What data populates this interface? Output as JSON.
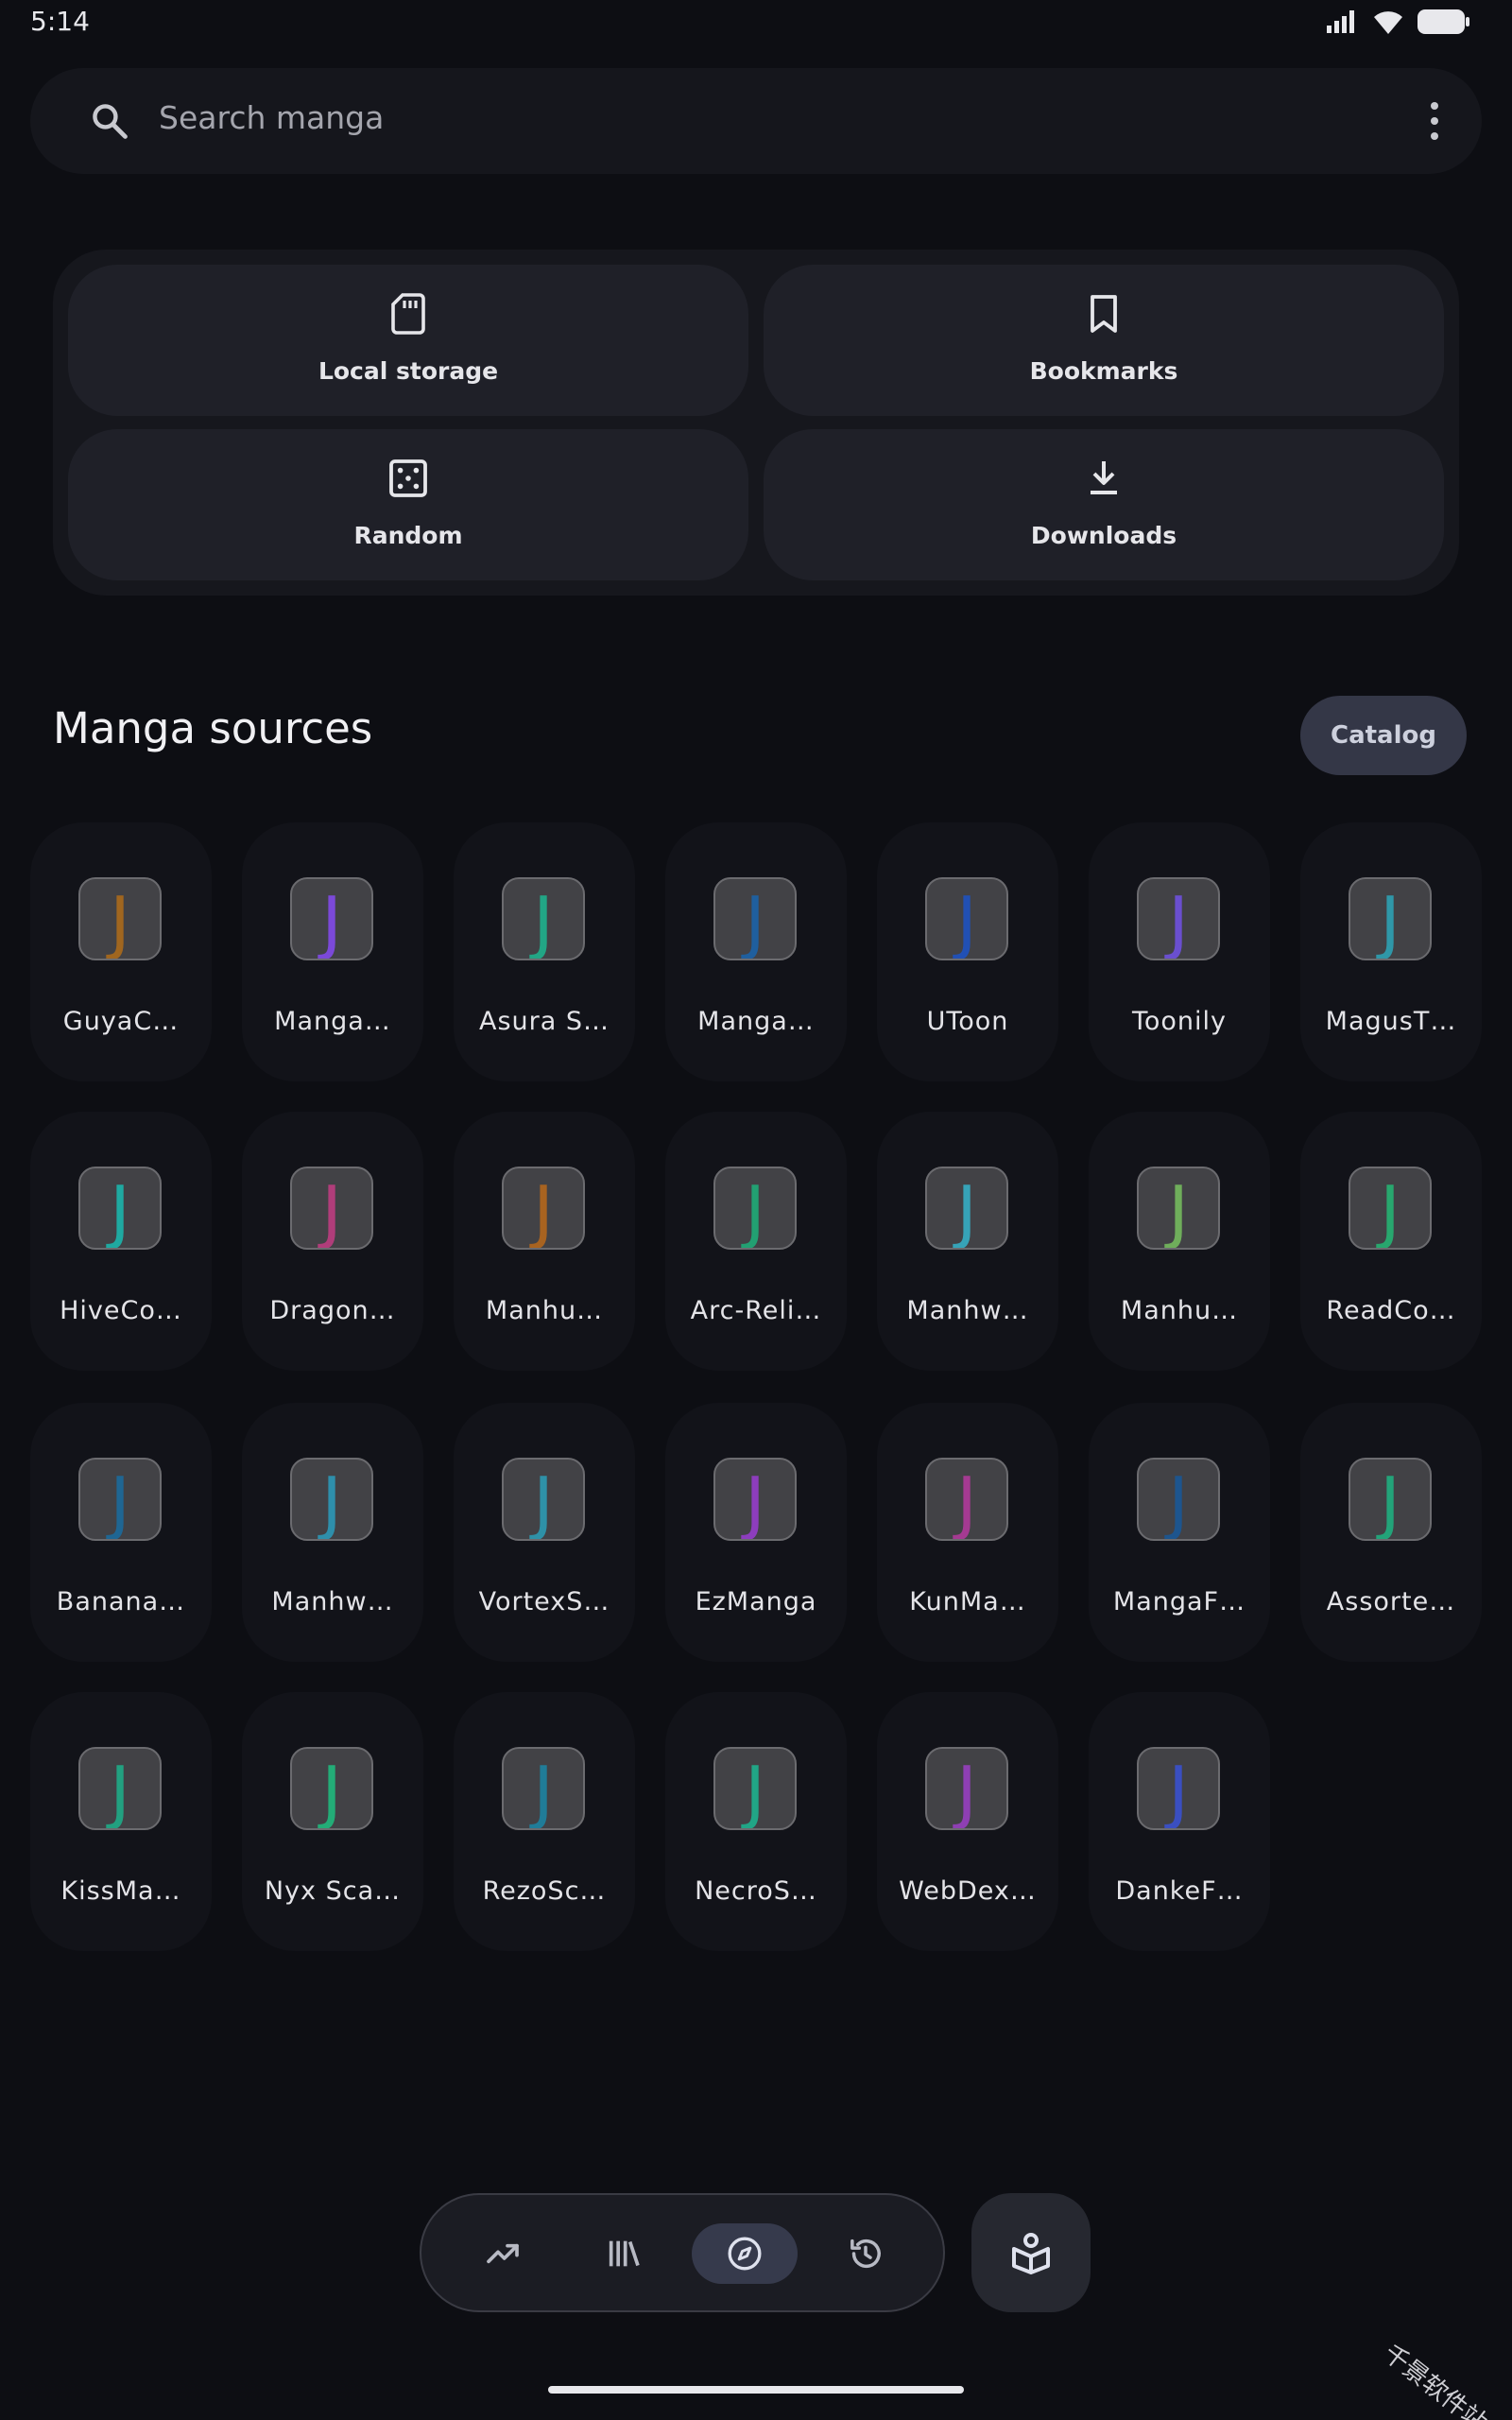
{
  "status_bar": {
    "time": "5:14"
  },
  "search": {
    "placeholder": "Search manga"
  },
  "shortcuts": [
    {
      "label": "Local storage",
      "icon": "sd-card-icon"
    },
    {
      "label": "Bookmarks",
      "icon": "bookmark-icon"
    },
    {
      "label": "Random",
      "icon": "dice-icon"
    },
    {
      "label": "Downloads",
      "icon": "download-icon"
    }
  ],
  "sources_section": {
    "title": "Manga sources",
    "catalog_label": "Catalog"
  },
  "sources": [
    {
      "name": "GuyaC…",
      "glyph": "J",
      "color": "#a0661f"
    },
    {
      "name": "Manga…",
      "glyph": "J",
      "color": "#7b49d8"
    },
    {
      "name": "Asura S…",
      "glyph": "J",
      "color": "#22a585"
    },
    {
      "name": "Manga…",
      "glyph": "J",
      "color": "#1f5f9e"
    },
    {
      "name": "UToon",
      "glyph": "J",
      "color": "#2150b4"
    },
    {
      "name": "Toonily",
      "glyph": "J",
      "color": "#6a4fcf"
    },
    {
      "name": "MagusT…",
      "glyph": "J",
      "color": "#2f97a8"
    },
    {
      "name": "HiveCo…",
      "glyph": "J",
      "color": "#1fa9a1"
    },
    {
      "name": "Dragon…",
      "glyph": "J",
      "color": "#b03d7a"
    },
    {
      "name": "Manhu…",
      "glyph": "J",
      "color": "#a86320"
    },
    {
      "name": "Arc-Reli…",
      "glyph": "J",
      "color": "#22a072"
    },
    {
      "name": "Manhw…",
      "glyph": "J",
      "color": "#36a3b8"
    },
    {
      "name": "Manhu…",
      "glyph": "J",
      "color": "#6fae5b"
    },
    {
      "name": "ReadCo…",
      "glyph": "J",
      "color": "#28a76e"
    },
    {
      "name": "Banana…",
      "glyph": "J",
      "color": "#1f6693"
    },
    {
      "name": "Manhw…",
      "glyph": "J",
      "color": "#2e8fab"
    },
    {
      "name": "VortexS…",
      "glyph": "J",
      "color": "#2e91a7"
    },
    {
      "name": "EzManga",
      "glyph": "J",
      "color": "#8d3dbd"
    },
    {
      "name": "KunMa…",
      "glyph": "J",
      "color": "#a53a92"
    },
    {
      "name": "MangaF…",
      "glyph": "J",
      "color": "#1d558e"
    },
    {
      "name": "Assorte…",
      "glyph": "J",
      "color": "#23a379"
    },
    {
      "name": "KissMa…",
      "glyph": "J",
      "color": "#22a080"
    },
    {
      "name": "Nyx Sca…",
      "glyph": "J",
      "color": "#23ac77"
    },
    {
      "name": "RezoSc…",
      "glyph": "J",
      "color": "#207c98"
    },
    {
      "name": "NecroS…",
      "glyph": "J",
      "color": "#21a586"
    },
    {
      "name": "WebDex…",
      "glyph": "J",
      "color": "#8e3fb3"
    },
    {
      "name": "DankeF…",
      "glyph": "J",
      "color": "#3a4fc1"
    }
  ],
  "bottom_nav": {
    "items": [
      {
        "icon": "trending-icon",
        "active": false
      },
      {
        "icon": "library-icon",
        "active": false
      },
      {
        "icon": "explore-icon",
        "active": true
      },
      {
        "icon": "history-icon",
        "active": false
      }
    ],
    "profile_icon": "reader-profile-icon"
  },
  "watermark": "千景软件站",
  "colors": {
    "background": "#0d0e13",
    "surface": "#16171d",
    "tile": "#1f2028",
    "accent_chip": "#343747"
  }
}
